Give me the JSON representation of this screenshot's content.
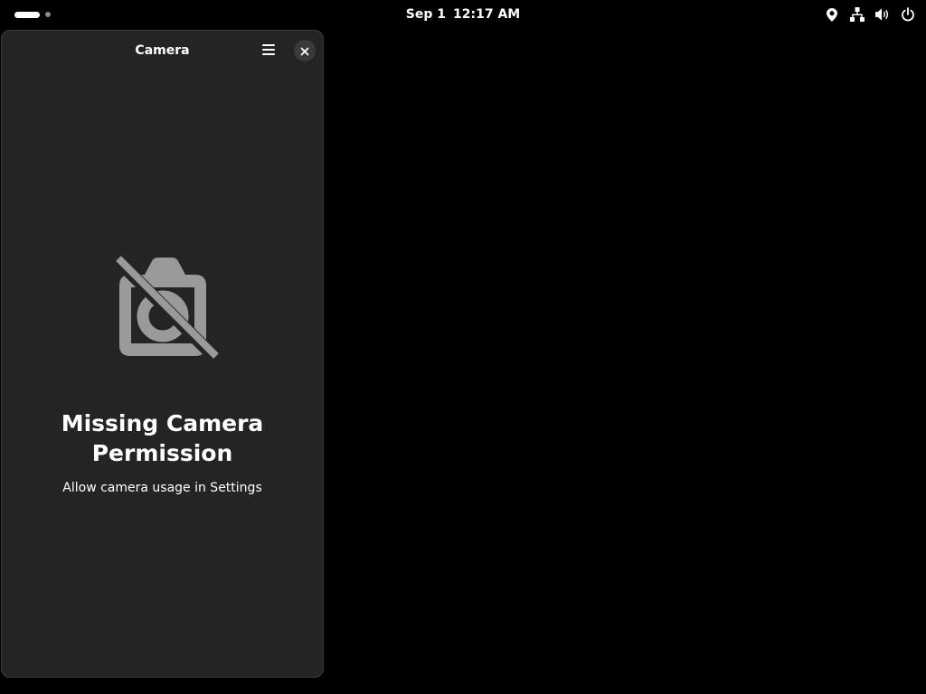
{
  "topbar": {
    "date": "Sep 1",
    "time": "12:17 AM",
    "icons": [
      "location-icon",
      "network-wired-icon",
      "volume-icon",
      "power-icon"
    ]
  },
  "window": {
    "title": "Camera",
    "menu_icon": "hamburger-menu-icon",
    "close_icon": "close-icon"
  },
  "status": {
    "icon": "camera-disabled-icon",
    "title": "Missing Camera Permission",
    "description": "Allow camera usage in Settings"
  },
  "colors": {
    "background": "#000000",
    "window_bg": "#242424",
    "icon_gray": "#9a9a9a",
    "text": "#ffffff"
  }
}
